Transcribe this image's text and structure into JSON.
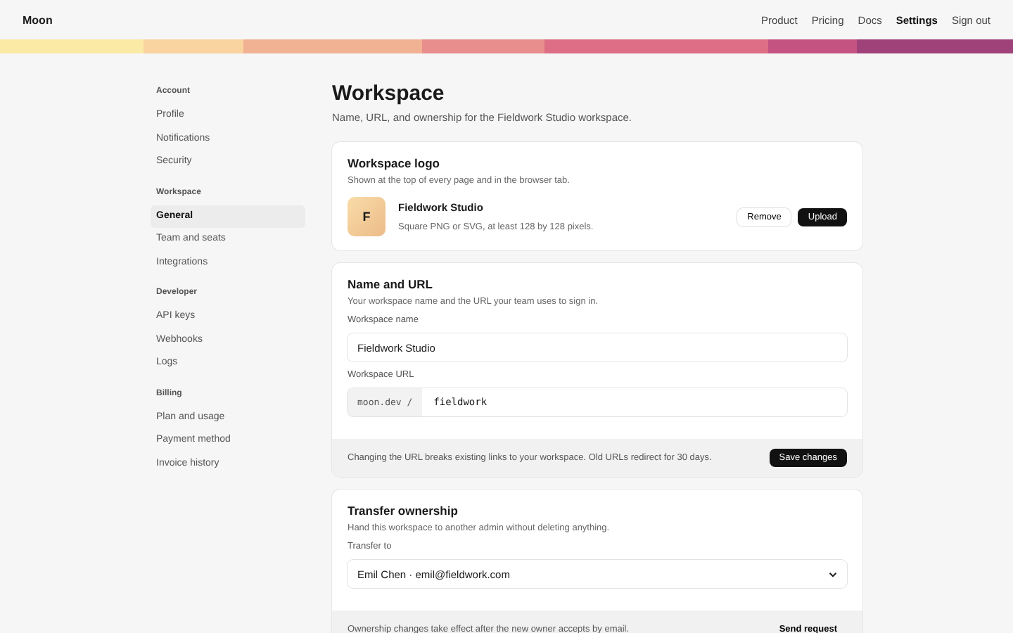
{
  "brand": "Moon",
  "nav": [
    {
      "label": "Product",
      "selected": false
    },
    {
      "label": "Pricing",
      "selected": false
    },
    {
      "label": "Docs",
      "selected": false
    },
    {
      "label": "Settings",
      "selected": true
    },
    {
      "label": "Sign out",
      "selected": false
    }
  ],
  "sidebar": {
    "groups": [
      {
        "title": "Account",
        "items": [
          {
            "label": "Profile",
            "selected": false
          },
          {
            "label": "Notifications",
            "selected": false
          },
          {
            "label": "Security",
            "selected": false
          }
        ]
      },
      {
        "title": "Workspace",
        "items": [
          {
            "label": "General",
            "selected": true
          },
          {
            "label": "Team and seats",
            "selected": false
          },
          {
            "label": "Integrations",
            "selected": false
          }
        ]
      },
      {
        "title": "Developer",
        "items": [
          {
            "label": "API keys",
            "selected": false
          },
          {
            "label": "Webhooks",
            "selected": false
          },
          {
            "label": "Logs",
            "selected": false
          }
        ]
      },
      {
        "title": "Billing",
        "items": [
          {
            "label": "Plan and usage",
            "selected": false
          },
          {
            "label": "Payment method",
            "selected": false
          },
          {
            "label": "Invoice history",
            "selected": false
          }
        ]
      }
    ]
  },
  "page": {
    "title": "Workspace",
    "subtitle": "Name, URL, and ownership for the Fieldwork Studio workspace."
  },
  "logo_card": {
    "title": "Workspace logo",
    "description": "Shown at the top of every page and in the browser tab.",
    "logo_letter": "F",
    "name": "Fieldwork Studio",
    "hint": "Square PNG or SVG, at least 128 by 128 pixels.",
    "buttons": [
      {
        "label": "Remove",
        "kind": "secondary"
      },
      {
        "label": "Upload",
        "kind": "primary"
      }
    ]
  },
  "name_card": {
    "title": "Name and URL",
    "description": "Your workspace name and the URL your team uses to sign in.",
    "fields": [
      {
        "label": "Workspace name",
        "value": "Fieldwork Studio"
      },
      {
        "label": "Workspace URL",
        "prefix": "moon.dev /",
        "value": "fieldwork"
      }
    ],
    "footer": {
      "note": "Changing the URL breaks existing links to your workspace. Old URLs redirect for 30 days.",
      "button": "Save changes"
    }
  },
  "transfer_card": {
    "title": "Transfer ownership",
    "description": "Hand this workspace to another admin without deleting anything.",
    "field": {
      "label": "Transfer to",
      "value": "Emil Chen · emil@fieldwork.com"
    },
    "footer": {
      "note": "Ownership changes take effect after the new owner accepts by email.",
      "button": "Send request"
    }
  }
}
